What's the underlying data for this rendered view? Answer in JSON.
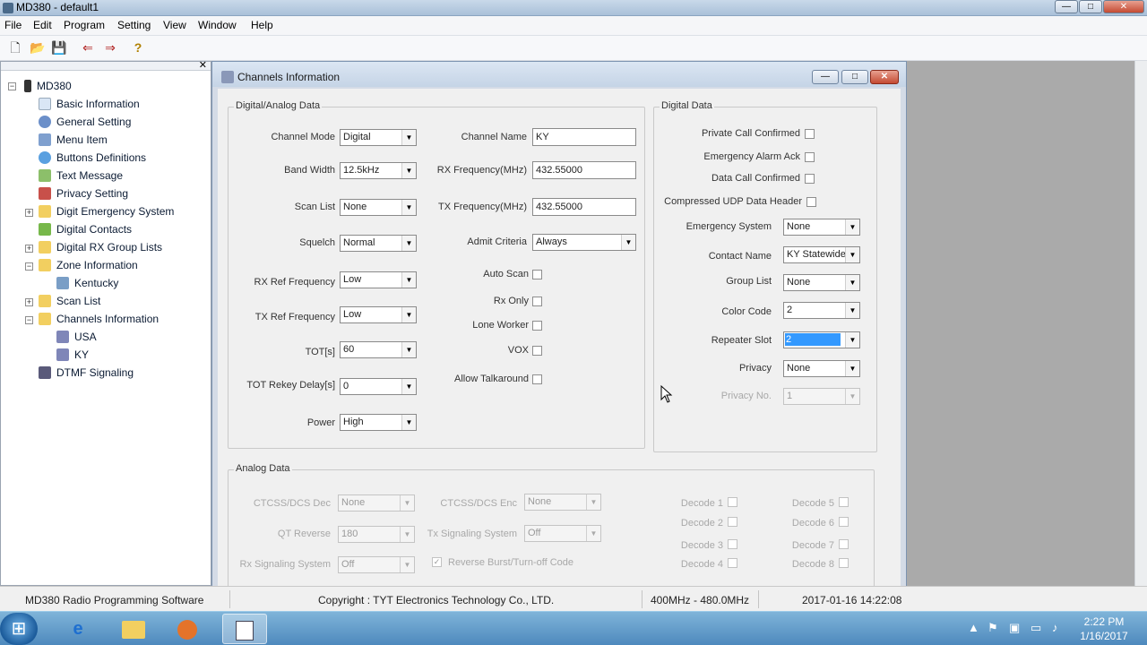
{
  "window": {
    "title": "MD380 - default1",
    "minimize": "—",
    "maximize": "□",
    "close": "✕"
  },
  "menu": [
    "File",
    "Edit",
    "Program",
    "Setting",
    "View",
    "Window",
    "Help"
  ],
  "toolbar": {
    "new": "🗋",
    "open": "📂",
    "save": "💾",
    "read": "⇐",
    "write": "⇒",
    "help": "?"
  },
  "tree": {
    "root": "MD380",
    "close": "✕",
    "items": [
      {
        "label": "Basic Information",
        "icon": "document-icon",
        "color": "#d9e6f5"
      },
      {
        "label": "General Setting",
        "icon": "gear-icon",
        "color": "#6b8fc9"
      },
      {
        "label": "Menu Item",
        "icon": "menu-icon",
        "color": "#7fa0cf"
      },
      {
        "label": "Buttons Definitions",
        "icon": "button-icon",
        "color": "#5aa0e0"
      },
      {
        "label": "Text Message",
        "icon": "message-icon",
        "color": "#8cbf6a"
      },
      {
        "label": "Privacy Setting",
        "icon": "key-icon",
        "color": "#c8504a"
      },
      {
        "label": "Digit Emergency System",
        "icon": "folder-icon",
        "color": "#f2cf60"
      },
      {
        "label": "Digital Contacts",
        "icon": "contact-icon",
        "color": "#77b84a"
      },
      {
        "label": "Digital RX Group Lists",
        "icon": "folder-icon",
        "color": "#f2cf60"
      },
      {
        "label": "Zone Information",
        "icon": "folder-icon",
        "color": "#f2cf60"
      },
      {
        "label": "Kentucky",
        "icon": "zone-icon",
        "color": "#7a9ec6"
      },
      {
        "label": "Scan List",
        "icon": "folder-icon",
        "color": "#f2cf60"
      },
      {
        "label": "Channels Information",
        "icon": "folder-icon",
        "color": "#f2cf60"
      },
      {
        "label": "USA",
        "icon": "channel-icon",
        "color": "#7f86b8"
      },
      {
        "label": "KY",
        "icon": "channel-icon",
        "color": "#7f86b8"
      },
      {
        "label": "DTMF Signaling",
        "icon": "dtmf-icon",
        "color": "#5a5a7a"
      }
    ]
  },
  "child": {
    "title": "Channels Information",
    "min": "—",
    "max": "□",
    "close": "✕"
  },
  "digital_analog": {
    "title": "Digital/Analog Data",
    "channel_mode": {
      "label": "Channel Mode",
      "value": "Digital"
    },
    "band_width": {
      "label": "Band Width",
      "value": "12.5kHz"
    },
    "scan_list": {
      "label": "Scan List",
      "value": "None"
    },
    "squelch": {
      "label": "Squelch",
      "value": "Normal"
    },
    "rx_ref": {
      "label": "RX Ref Frequency",
      "value": "Low"
    },
    "tx_ref": {
      "label": "TX Ref Frequency",
      "value": "Low"
    },
    "tot": {
      "label": "TOT[s]",
      "value": "60"
    },
    "tot_rekey": {
      "label": "TOT Rekey Delay[s]",
      "value": "0"
    },
    "power": {
      "label": "Power",
      "value": "High"
    },
    "channel_name": {
      "label": "Channel Name",
      "value": "KY"
    },
    "rx_freq": {
      "label": "RX Frequency(MHz)",
      "value": "432.55000"
    },
    "tx_freq": {
      "label": "TX Frequency(MHz)",
      "value": "432.55000"
    },
    "admit": {
      "label": "Admit Criteria",
      "value": "Always"
    },
    "auto_scan": {
      "label": "Auto Scan",
      "checked": false
    },
    "rx_only": {
      "label": "Rx Only",
      "checked": false
    },
    "lone_worker": {
      "label": "Lone Worker",
      "checked": false
    },
    "vox": {
      "label": "VOX",
      "checked": false
    },
    "talkaround": {
      "label": "Allow Talkaround",
      "checked": false
    }
  },
  "digital": {
    "title": "Digital Data",
    "private_call": {
      "label": "Private Call Confirmed",
      "checked": false
    },
    "emergency_ack": {
      "label": "Emergency Alarm Ack",
      "checked": false
    },
    "data_call": {
      "label": "Data Call Confirmed",
      "checked": false
    },
    "udp_header": {
      "label": "Compressed UDP Data Header",
      "checked": false
    },
    "emergency_system": {
      "label": "Emergency System",
      "value": "None"
    },
    "contact_name": {
      "label": "Contact Name",
      "value": "KY Statewide"
    },
    "group_list": {
      "label": "Group List",
      "value": "None"
    },
    "color_code": {
      "label": "Color Code",
      "value": "2"
    },
    "repeater_slot": {
      "label": "Repeater Slot",
      "value": "2"
    },
    "privacy": {
      "label": "Privacy",
      "value": "None"
    },
    "privacy_no": {
      "label": "Privacy No.",
      "value": "1"
    }
  },
  "analog": {
    "title": "Analog Data",
    "ctcss_dec": {
      "label": "CTCSS/DCS Dec",
      "value": "None"
    },
    "ctcss_enc": {
      "label": "CTCSS/DCS Enc",
      "value": "None"
    },
    "qt_reverse": {
      "label": "QT Reverse",
      "value": "180"
    },
    "tx_signaling": {
      "label": "Tx Signaling System",
      "value": "Off"
    },
    "rx_signaling": {
      "label": "Rx Signaling System",
      "value": "Off"
    },
    "reverse_burst": {
      "label": "Reverse Burst/Turn-off Code",
      "checked": true
    },
    "decodes": [
      "Decode 1",
      "Decode 2",
      "Decode 3",
      "Decode 4",
      "Decode 5",
      "Decode 6",
      "Decode 7",
      "Decode 8"
    ]
  },
  "status": {
    "app": "MD380 Radio Programming Software",
    "copyright": "Copyright : TYT Electronics Technology Co., LTD.",
    "band": "400MHz - 480.0MHz",
    "datetime": "2017-01-16 14:22:08"
  },
  "taskbar": {
    "start": "⊞",
    "time": "2:22 PM",
    "date": "1/16/2017"
  },
  "arrow": "▼",
  "check": "✓"
}
